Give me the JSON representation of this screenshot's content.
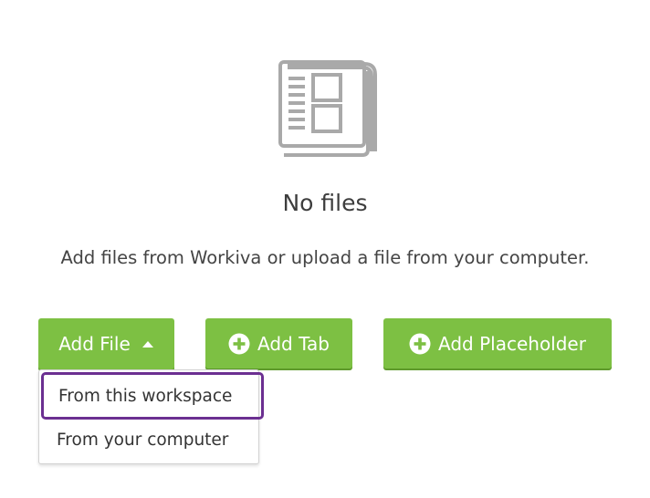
{
  "empty_state": {
    "icon": "files-icon",
    "title": "No files",
    "message": "Add files from Workiva or upload a file from your computer."
  },
  "actions": {
    "add_file_label": "Add File",
    "add_tab_label": "Add Tab",
    "add_placeholder_label": "Add Placeholder"
  },
  "dropdown": {
    "items": [
      {
        "label": "From this workspace",
        "highlighted": true
      },
      {
        "label": "From your computer",
        "highlighted": false
      }
    ]
  },
  "colors": {
    "button_green": "#7dc043",
    "focus_purple": "#6b2f91",
    "icon_gray": "#a9a9a9"
  }
}
